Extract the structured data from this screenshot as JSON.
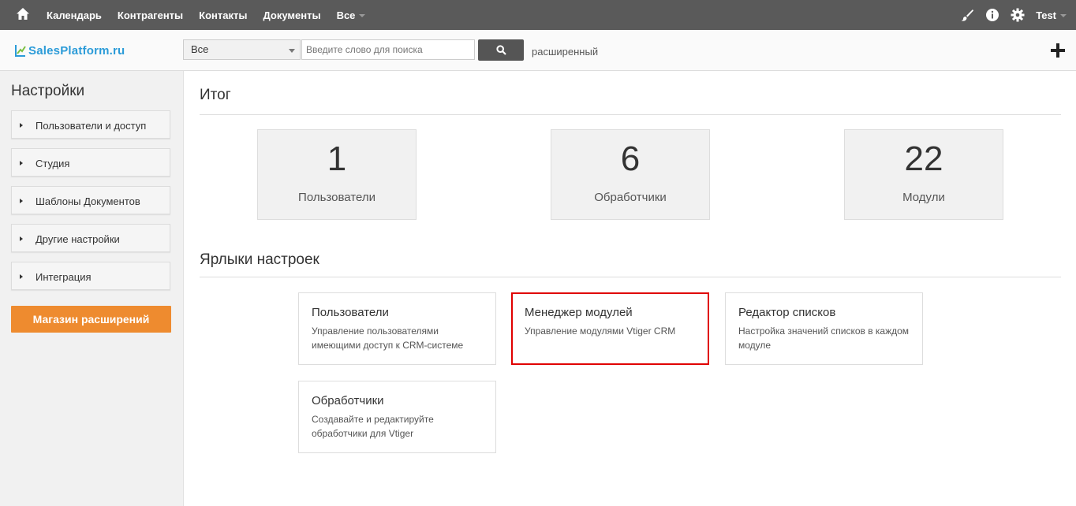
{
  "topnav": {
    "items": [
      "Календарь",
      "Контрагенты",
      "Контакты",
      "Документы",
      "Все"
    ],
    "user": "Test"
  },
  "searchbar": {
    "logo": "SalesPlatform.ru",
    "scope": "Все",
    "placeholder": "Введите слово для поиска",
    "advanced": "расширенный"
  },
  "sidebar": {
    "title": "Настройки",
    "items": [
      "Пользователи и доступ",
      "Студия",
      "Шаблоны Документов",
      "Другие настройки",
      "Интеграция"
    ],
    "store_button": "Магазин расширений"
  },
  "summary": {
    "title": "Итог",
    "stats": [
      {
        "value": "1",
        "label": "Пользователи"
      },
      {
        "value": "6",
        "label": "Обработчики"
      },
      {
        "value": "22",
        "label": "Модули"
      }
    ]
  },
  "shortcuts": {
    "title": "Ярлыки настроек",
    "cards": [
      {
        "title": "Пользователи",
        "desc": "Управление пользователями имеющими доступ к CRM-системе"
      },
      {
        "title": "Менеджер модулей",
        "desc": "Управление модулями Vtiger CRM"
      },
      {
        "title": "Редактор списков",
        "desc": "Настройка значений списков в каждом модуле"
      },
      {
        "title": "Обработчики",
        "desc": "Создавайте и редактируйте обработчики для Vtiger"
      }
    ]
  },
  "colors": {
    "topnav_bg": "#5a5a5a",
    "accent_orange": "#ee8b2f",
    "logo_blue": "#2b9bd8",
    "highlight_red": "#e00000"
  }
}
